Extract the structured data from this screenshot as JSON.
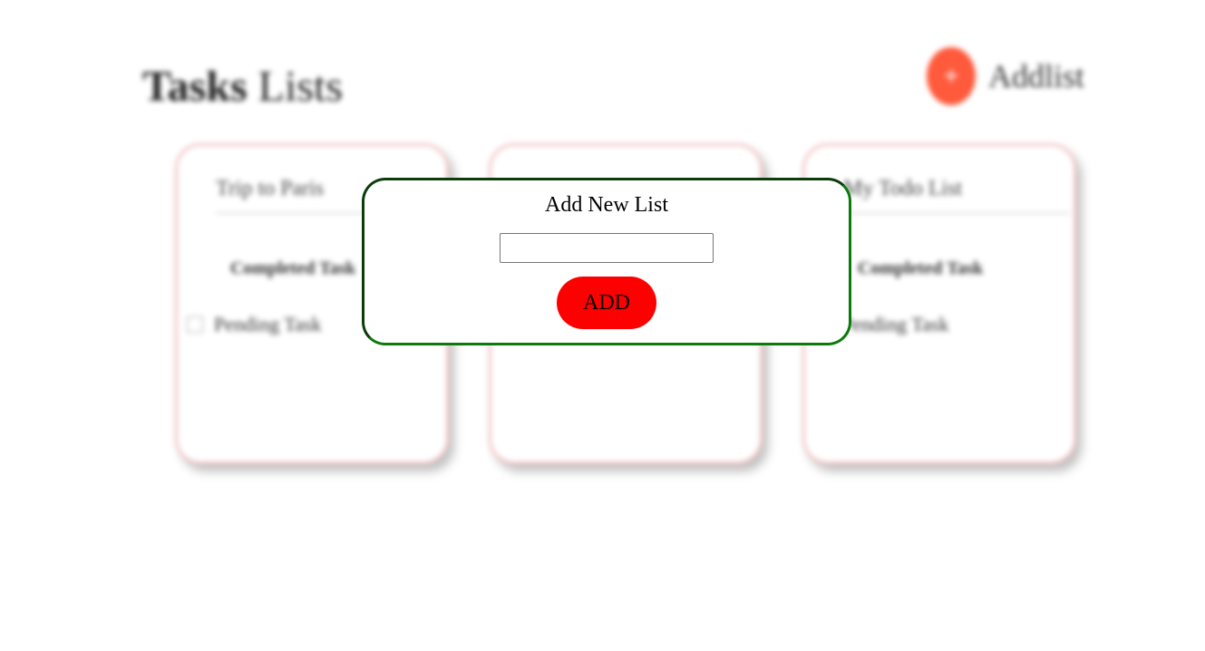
{
  "header": {
    "title_bold": "Tasks",
    "title_rest": " Lists",
    "add_icon_glyph": "+",
    "add_list_label": "Addlist",
    "accent_color": "#ff5a3c"
  },
  "cards": [
    {
      "title": "Trip to Paris",
      "completed_task": "Completed Task",
      "pending_task": "Pending Task"
    },
    {
      "title": "",
      "completed_task": "",
      "pending_task": ""
    },
    {
      "title": "My Todo List",
      "completed_task": "Completed Task",
      "pending_task": "Pending Task"
    }
  ],
  "modal": {
    "title": "Add New List",
    "input_value": "",
    "input_placeholder": "",
    "add_button_label": "ADD",
    "border_color": "#0a7a0a",
    "button_color": "#ff0000"
  }
}
